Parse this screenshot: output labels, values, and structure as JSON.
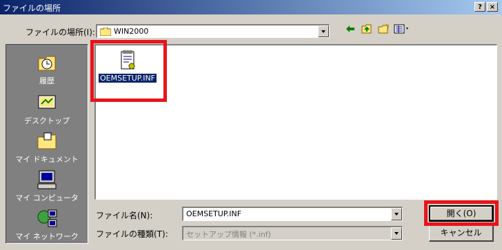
{
  "window": {
    "title": "ファイルの場所",
    "help_label": "?",
    "close_label": "×"
  },
  "location": {
    "label": "ファイルの場所(I):",
    "value": "WIN2000"
  },
  "toolbar": {
    "back_icon": "back-arrow-icon",
    "up_icon": "up-folder-icon",
    "new_folder_icon": "new-folder-icon",
    "view_menu_icon": "view-menu-icon"
  },
  "places": [
    {
      "label": "履歴",
      "icon": "history-icon"
    },
    {
      "label": "デスクトップ",
      "icon": "desktop-icon"
    },
    {
      "label": "マイ ドキュメント",
      "icon": "my-documents-icon"
    },
    {
      "label": "マイ コンピュータ",
      "icon": "my-computer-icon"
    },
    {
      "label": "マイ ネットワーク",
      "icon": "my-network-icon"
    }
  ],
  "files": [
    {
      "name": "OEMSETUP.INF",
      "icon": "inf-file-icon",
      "selected": true
    }
  ],
  "filename": {
    "label": "ファイル名(N):",
    "value": "OEMSETUP.INF"
  },
  "filetype": {
    "label": "ファイルの種類(T):",
    "value": "セットアップ情報 (*.inf)"
  },
  "buttons": {
    "open": "開く(O)",
    "cancel": "キャンセル"
  },
  "colors": {
    "highlight": "#e8141c",
    "selection": "#0a246a",
    "title_bar": "#0a246a"
  }
}
